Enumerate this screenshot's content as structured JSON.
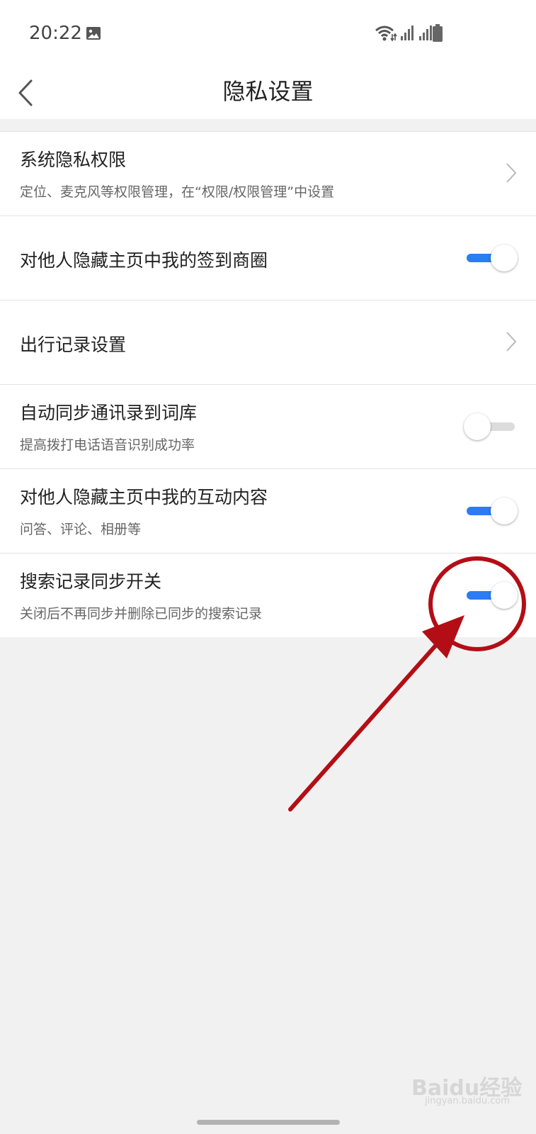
{
  "status_bar": {
    "time": "20:22",
    "icons": [
      "image-icon",
      "wifi-icon",
      "signal-icon",
      "signal-icon",
      "battery-icon"
    ]
  },
  "header": {
    "title": "隐私设置",
    "back_icon": "chevron-left-icon"
  },
  "settings": [
    {
      "title": "系统隐私权限",
      "subtitle": "定位、麦克风等权限管理，在“权限/权限管理”中设置",
      "control": "chevron"
    },
    {
      "title": "对他人隐藏主页中我的签到商圈",
      "control": "toggle",
      "on": true
    },
    {
      "title": "出行记录设置",
      "control": "chevron"
    },
    {
      "title": "自动同步通讯录到词库",
      "subtitle": "提高拨打电话语音识别成功率",
      "control": "toggle",
      "on": false
    },
    {
      "title": "对他人隐藏主页中我的互动内容",
      "subtitle": "问答、评论、相册等",
      "control": "toggle",
      "on": true
    },
    {
      "title": "搜索记录同步开关",
      "subtitle": "关闭后不再同步并删除已同步的搜索记录",
      "control": "toggle",
      "on": true
    }
  ],
  "colors": {
    "toggle_on": "#2b7cf5",
    "toggle_off": "#dcdcdc",
    "annotation": "#b30e16"
  },
  "watermark": {
    "brand": "Baidu经验",
    "url": "jingyan.baidu.com"
  }
}
